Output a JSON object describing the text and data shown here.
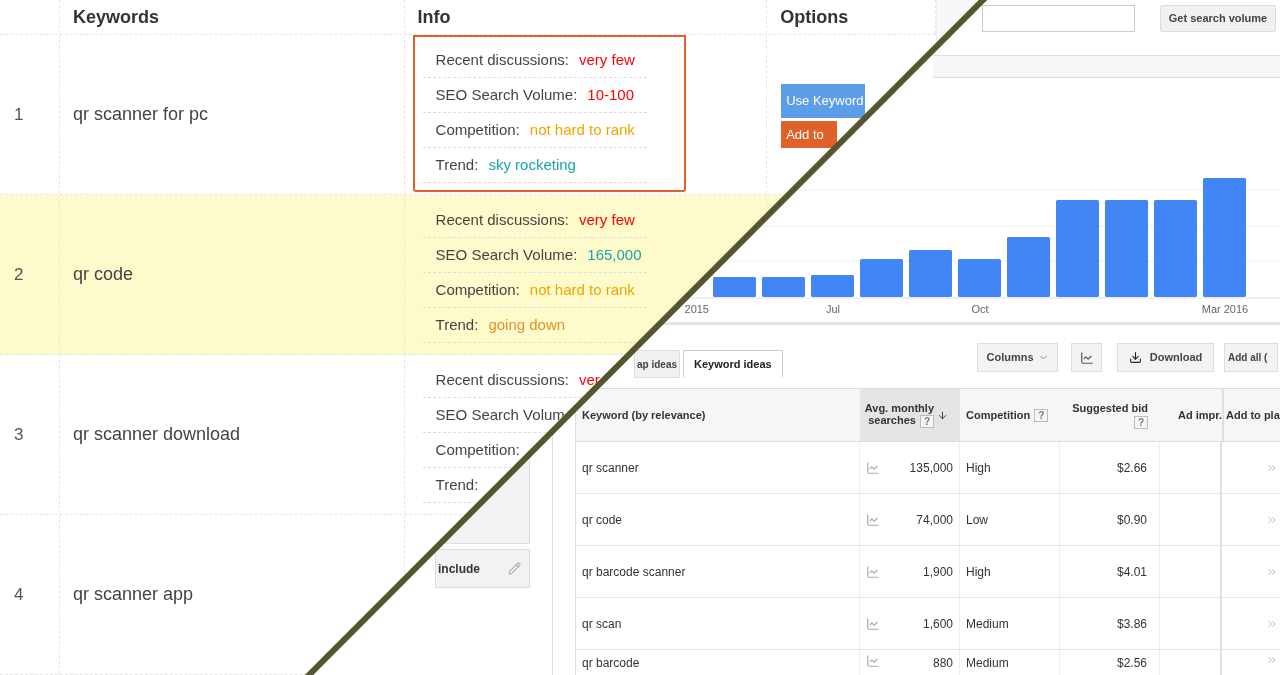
{
  "keyword_table": {
    "columns": [
      "Keywords",
      "Info",
      "Options"
    ],
    "rows": [
      {
        "number": "1",
        "keyword": "qr scanner for pc",
        "highlighted": false,
        "boxed": true,
        "info": [
          {
            "label": "Recent discussions:",
            "value": "very few",
            "color": "#ff0000"
          },
          {
            "label": "SEO Search Volume:",
            "value": "10-100",
            "color": "#ff0000"
          },
          {
            "label": "Competition:",
            "value": "not hard to rank",
            "color": "#f0a500"
          },
          {
            "label": "Trend:",
            "value": "sky rocketing",
            "color": "#1aa5a5"
          }
        ],
        "options": [
          {
            "label": "Use Keyword",
            "kind": "primary"
          },
          {
            "label": "Add to",
            "kind": "secondary"
          }
        ]
      },
      {
        "number": "2",
        "keyword": "qr code",
        "highlighted": true,
        "boxed": false,
        "info": [
          {
            "label": "Recent discussions:",
            "value": "very few",
            "color": "#ff0000"
          },
          {
            "label": "SEO Search Volume:",
            "value": "165,000",
            "color": "#1aa5a5"
          },
          {
            "label": "Competition:",
            "value": "not hard to rank",
            "color": "#f0a500"
          },
          {
            "label": "Trend:",
            "value": "going down",
            "color": "#e8902f"
          }
        ]
      },
      {
        "number": "3",
        "keyword": "qr scanner download",
        "highlighted": false,
        "boxed": false,
        "info": [
          {
            "label": "Recent discussions:",
            "value": "ver",
            "color": "#ff0000"
          },
          {
            "label": "SEO Search Volum"
          },
          {
            "label": "Competition:"
          },
          {
            "label": "Trend:"
          }
        ]
      },
      {
        "number": "4",
        "keyword": "qr scanner app",
        "highlighted": false,
        "boxed": false
      }
    ]
  },
  "planner": {
    "search_button": "Get search volume",
    "chart": {
      "axis_labels": [
        "2015",
        "Jul",
        "Oct",
        "Mar 2016"
      ]
    },
    "sidebar": {
      "include_label": "include"
    },
    "tabs": [
      {
        "label": "ap ideas",
        "selected": false
      },
      {
        "label": "Keyword ideas",
        "selected": true
      }
    ],
    "toolbar": {
      "columns_button": "Columns",
      "download_button": "Download",
      "add_all_button": "Add all ("
    },
    "columns": [
      {
        "label": "Keyword (by relevance)"
      },
      {
        "label": "Avg. monthly searches",
        "help": "?",
        "sorted": true
      },
      {
        "label": "Competition",
        "help": "?"
      },
      {
        "label": "Suggested bid",
        "help": "?"
      },
      {
        "label": "Ad impr."
      },
      {
        "label": "Add to pla"
      }
    ],
    "rows": [
      {
        "keyword": "qr scanner",
        "searches": "135,000",
        "competition": "High",
        "bid": "$2.66"
      },
      {
        "keyword": "qr code",
        "searches": "74,000",
        "competition": "Low",
        "bid": "$0.90"
      },
      {
        "keyword": "qr barcode scanner",
        "searches": "1,900",
        "competition": "High",
        "bid": "$4.01"
      },
      {
        "keyword": "qr scan",
        "searches": "1,600",
        "competition": "Medium",
        "bid": "$3.86"
      },
      {
        "keyword": "qr barcode",
        "searches": "880",
        "competition": "Medium",
        "bid": "$2.56"
      }
    ]
  }
}
